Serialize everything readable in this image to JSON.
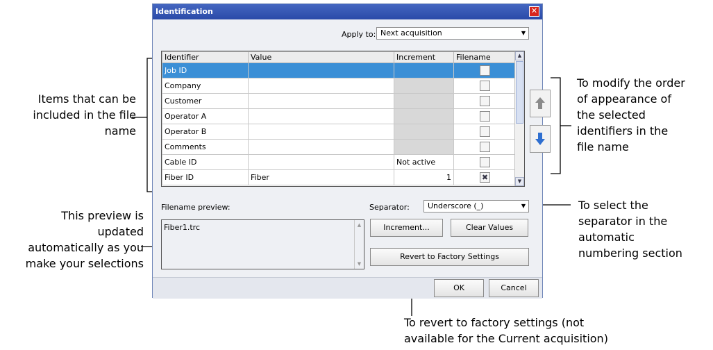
{
  "dialog": {
    "title": "Identification",
    "close_glyph": "✕",
    "apply_to_label": "Apply to:",
    "apply_to_value": "Next acquisition",
    "columns": [
      "Identifier",
      "Value",
      "Increment",
      "Filename"
    ],
    "rows": [
      {
        "identifier": "Job ID",
        "value": "",
        "increment": "",
        "filename_checked": false,
        "selected": true
      },
      {
        "identifier": "Company",
        "value": "",
        "increment": "",
        "filename_checked": false
      },
      {
        "identifier": "Customer",
        "value": "",
        "increment": "",
        "filename_checked": false
      },
      {
        "identifier": "Operator A",
        "value": "",
        "increment": "",
        "filename_checked": false
      },
      {
        "identifier": "Operator B",
        "value": "",
        "increment": "",
        "filename_checked": false
      },
      {
        "identifier": "Comments",
        "value": "",
        "increment": "",
        "filename_checked": false
      },
      {
        "identifier": "Cable ID",
        "value": "",
        "increment": "Not active",
        "filename_checked": false
      },
      {
        "identifier": "Fiber ID",
        "value": "Fiber",
        "increment": "1",
        "filename_checked": true
      }
    ],
    "filename_preview_label": "Filename preview:",
    "filename_preview_value": "Fiber1.trc",
    "separator_label": "Separator:",
    "separator_value": "Underscore (_)",
    "increment_button": "Increment...",
    "clear_values_button": "Clear Values",
    "revert_button": "Revert to Factory Settings",
    "ok_button": "OK",
    "cancel_button": "Cancel"
  },
  "callouts": {
    "items_line1": "Items that can be",
    "items_line2": "included in the file",
    "items_line3": "name",
    "preview_line1": "This preview is",
    "preview_line2": "updated",
    "preview_line3": "automatically as you",
    "preview_line4": "make your selections",
    "order_line1": "To modify the order",
    "order_line2": "of appearance of",
    "order_line3": "the selected",
    "order_line4": "identifiers in the",
    "order_line5": "file name",
    "separator_line1": "To select the",
    "separator_line2": "separator in the",
    "separator_line3": "automatic",
    "separator_line4": "numbering section",
    "revert_line1": "To revert to factory settings (not",
    "revert_line2": "available for the Current acquisition)"
  },
  "icons": {
    "move_up": "arrow-up-icon",
    "move_down": "arrow-down-icon",
    "checked_mark": "✖"
  },
  "colors": {
    "title_bar": "#2a4aa8",
    "selected_row": "#3b8fd6",
    "up_arrow": "#8a8a8a",
    "down_arrow": "#2f6fd0"
  }
}
